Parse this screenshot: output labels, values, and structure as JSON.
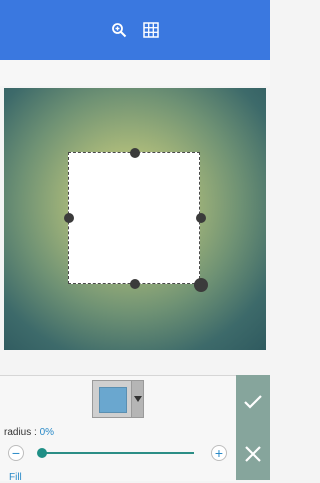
{
  "toolbar": {
    "zoom_icon": "zoom-in-icon",
    "grid_icon": "grid-icon"
  },
  "canvas": {
    "style": "radial gradient",
    "crop_shape": "square"
  },
  "controls": {
    "radius_label": "radius : ",
    "radius_value": "0%",
    "slider_value_percent": 0,
    "minus_label": "−",
    "plus_label": "+",
    "fill_label": "Fill",
    "swatch_color": "#6aa7cf"
  },
  "actions": {
    "confirm_icon": "check-icon",
    "cancel_icon": "close-icon"
  },
  "colors": {
    "accent": "#3a78e0",
    "side_panel": "#86a59c",
    "link": "#2a8ac8"
  }
}
